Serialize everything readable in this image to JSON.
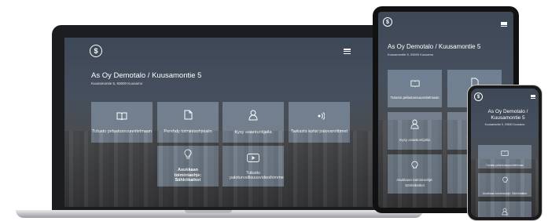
{
  "title": "As Oy Demotalo / Kuusamontie 5",
  "subtitle": "Kuusamontie 5, 93600 Kuusamo",
  "logo_glyph": "$",
  "tiles": [
    {
      "label": "Tutustu pelastussuunnitelmaan",
      "icon": "book-icon"
    },
    {
      "label": "Perehdy toimintaohjeisiin",
      "icon": "document-icon"
    },
    {
      "label": "Kysy asiantuntijalta",
      "icon": "person-icon"
    },
    {
      "label": "Tarkasta kotisi palovaroittimet",
      "icon": "smoke-alarm-icon"
    },
    {
      "label": "Asukkaan toimintaohje: Sähkökatkot",
      "icon": "bulb-icon"
    },
    {
      "label": "Tutustu paloturvallisuusvideoihimme",
      "icon": "play-icon"
    }
  ],
  "tablet": {
    "title": "As Oy Demotalo / Kuusamontie 5",
    "subtitle": "Kuusamontie 5, 93600 Kuusamo",
    "tiles": [
      {
        "label": "Tutustu pelastussuunnitelmaan"
      },
      {
        "label": "Perehdy"
      },
      {
        "label": "Kysy asiantuntijalta"
      },
      {
        "label": "Tarkasta k"
      },
      {
        "label": "Asukkaan toimintaohje: Sähkökatkot"
      },
      {
        "label": "paloturva"
      }
    ]
  },
  "phone": {
    "title": "As Oy Demotalo / Kuusamontie 5",
    "subtitle": "Kuusamontie 5, 93600 Kuusamo",
    "tiles": [
      {
        "label": "Tutustu pelastussuunnitelmaan"
      },
      {
        "label": "Asukkaan toimintaohje: Sähkökatkot"
      },
      {
        "label": ""
      }
    ]
  }
}
